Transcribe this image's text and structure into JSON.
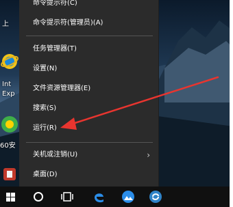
{
  "desktop": {
    "icon_labels": [
      "上",
      "Int",
      "Exp",
      "60安"
    ]
  },
  "context_menu": {
    "items": [
      {
        "label": "命令提示符(C)"
      },
      {
        "label": "命令提示符(管理员)(A)"
      },
      {
        "label": "任务管理器(T)"
      },
      {
        "label": "设置(N)"
      },
      {
        "label": "文件资源管理器(E)"
      },
      {
        "label": "搜索(S)"
      },
      {
        "label": "运行(R)"
      },
      {
        "label": "关机或注销(U)"
      },
      {
        "label": "桌面(D)"
      }
    ]
  },
  "annotation": {
    "color": "#e8352f"
  },
  "taskbar": {
    "icons": [
      "windows-start-icon",
      "cortana-circle-icon",
      "task-view-icon",
      "edge-browser-icon",
      "photo-viewer-icon",
      "360-browser-icon"
    ]
  }
}
